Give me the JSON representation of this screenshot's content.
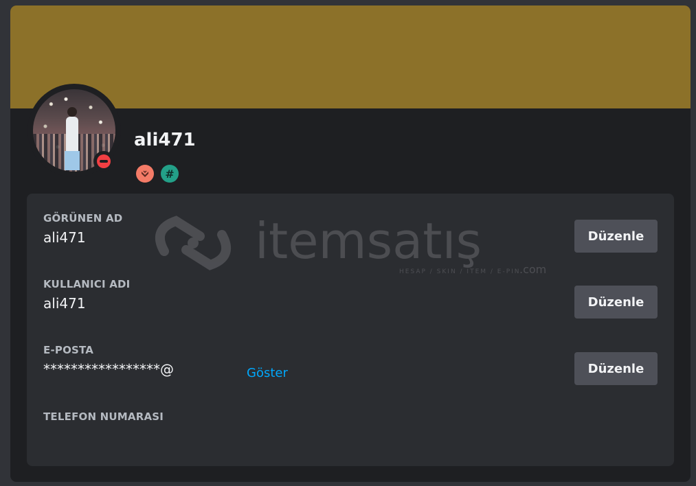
{
  "profile": {
    "username": "ali471",
    "status": "do-not-disturb",
    "banner_color": "#8c7129",
    "badges": [
      {
        "name": "hypesquad-icon",
        "color": "#f47b67"
      },
      {
        "name": "hash-icon",
        "glyph": "#",
        "color": "#23a088"
      }
    ]
  },
  "watermark": {
    "brand": "itemsatış",
    "tagline": "HESAP / SKIN / ITEM / E-PIN",
    "suffix": ".com"
  },
  "account": {
    "fields": [
      {
        "label": "GÖRÜNEN AD",
        "value": "ali471",
        "button": "Düzenle"
      },
      {
        "label": "KULLANICI ADI",
        "value": "ali471",
        "button": "Düzenle"
      },
      {
        "label": "E-POSTA",
        "value": "*****************@",
        "button": "Düzenle",
        "link": "Göster"
      },
      {
        "label": "TELEFON NUMARASI",
        "value": ""
      }
    ]
  },
  "colors": {
    "background": "#1e1f22",
    "panel": "#2b2d31",
    "button": "#4e5058",
    "link": "#00a8fc",
    "status_dnd": "#f23f43"
  }
}
